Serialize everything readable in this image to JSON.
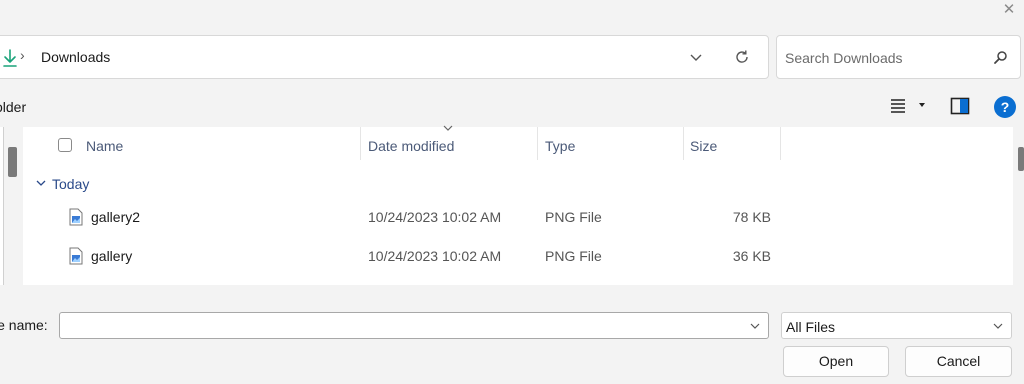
{
  "address": {
    "path_label": "Downloads"
  },
  "search": {
    "placeholder": "Search Downloads"
  },
  "toolbar": {
    "new_folder_label": "older"
  },
  "columns": {
    "name": "Name",
    "date": "Date modified",
    "type": "Type",
    "size": "Size"
  },
  "group": {
    "label": "Today"
  },
  "files": [
    {
      "name": "gallery2",
      "date": "10/24/2023 10:02 AM",
      "type": "PNG File",
      "size": "78 KB"
    },
    {
      "name": "gallery",
      "date": "10/24/2023 10:02 AM",
      "type": "PNG File",
      "size": "36 KB"
    }
  ],
  "bottom": {
    "file_name_label": "le name:",
    "file_name_value": "",
    "filter_value": "All Files",
    "open_label": "Open",
    "cancel_label": "Cancel"
  },
  "help": {
    "glyph": "?"
  },
  "colors": {
    "accent": "#0a6ed1",
    "download_icon": "#1aa37a"
  }
}
